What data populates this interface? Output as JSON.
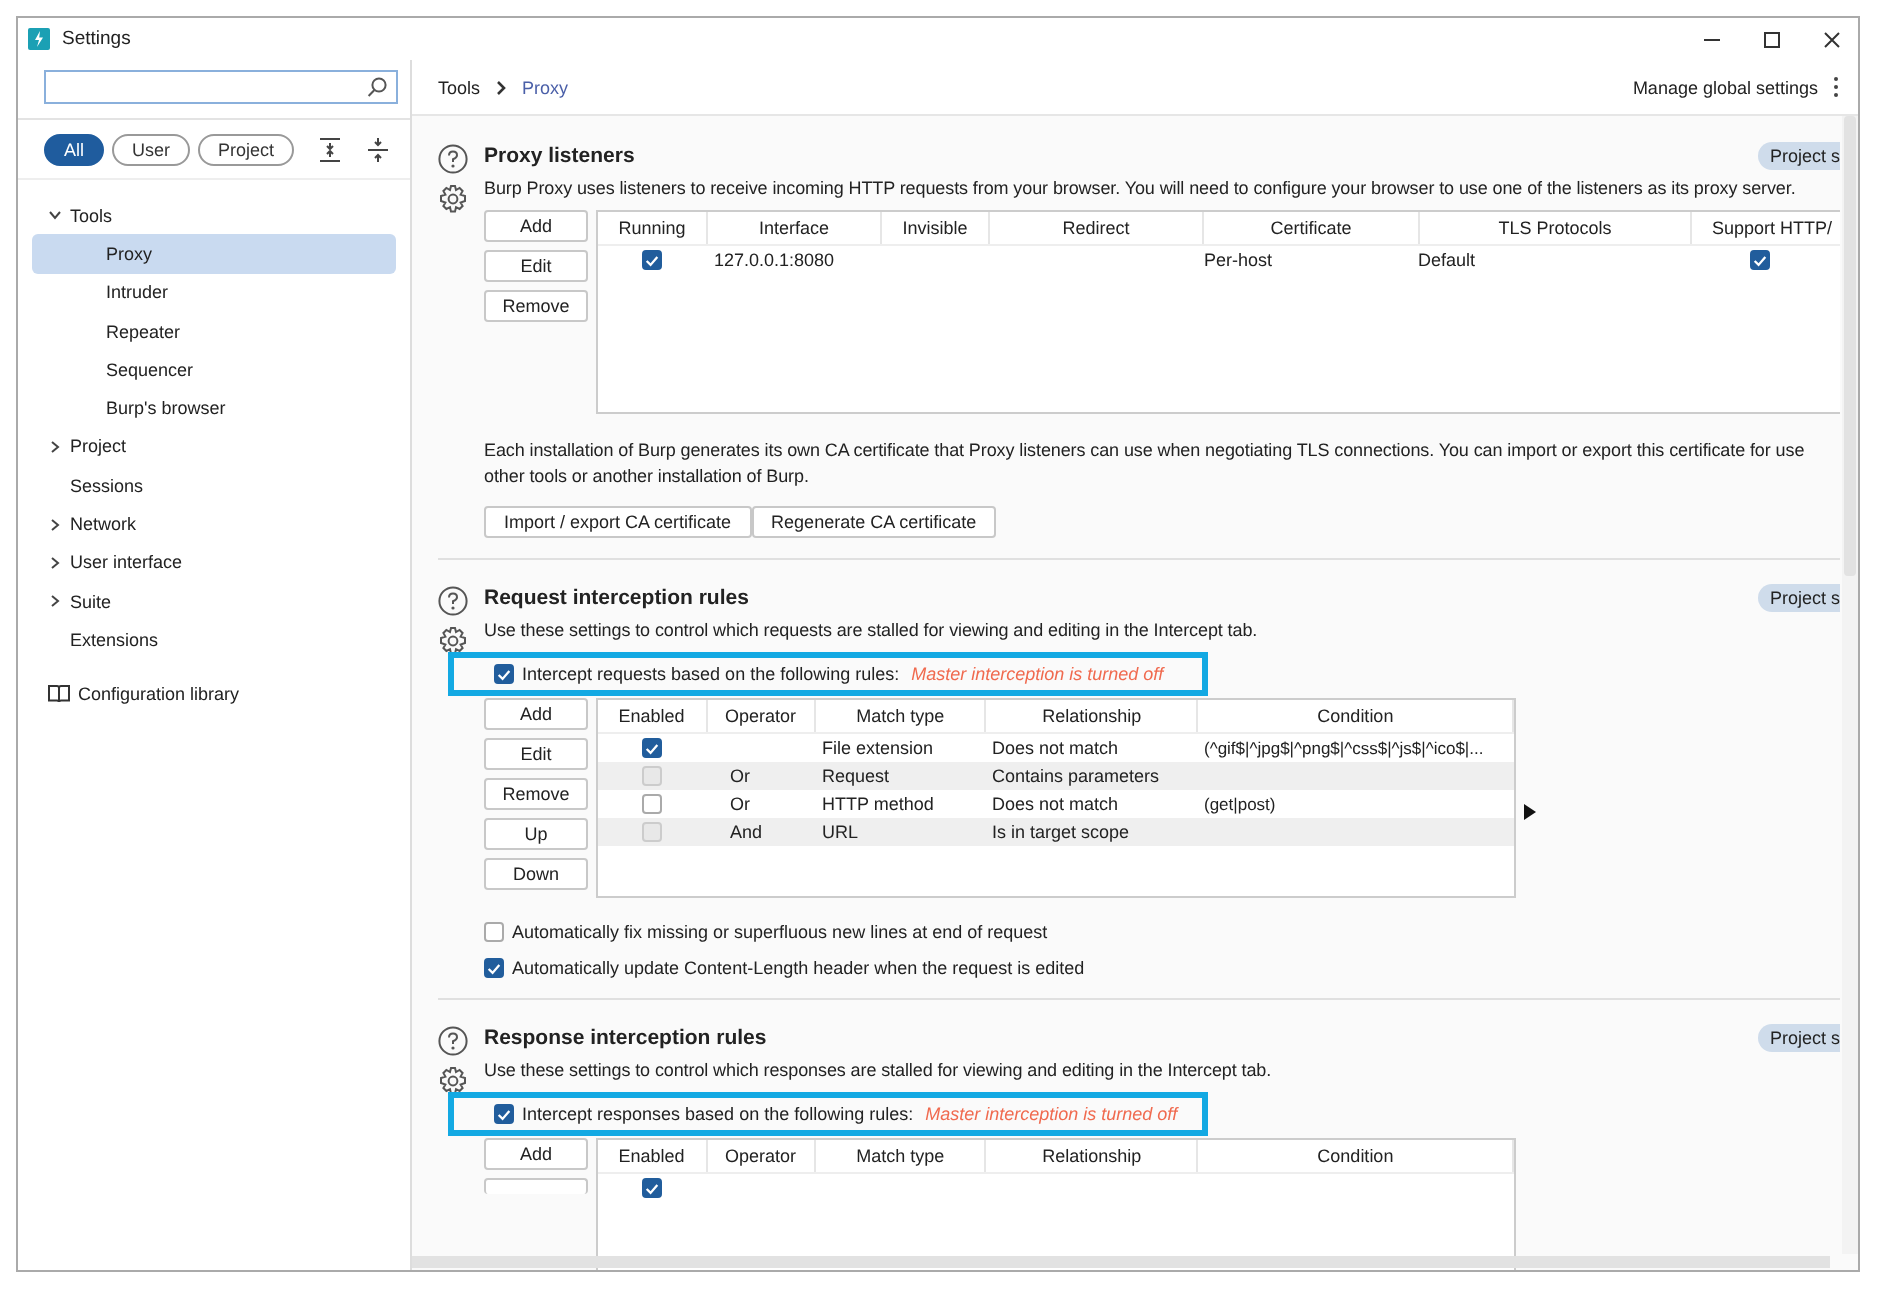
{
  "window": {
    "title": "Settings"
  },
  "sidebar": {
    "filters": [
      {
        "label": "All",
        "selected": true
      },
      {
        "label": "User",
        "selected": false
      },
      {
        "label": "Project",
        "selected": false
      }
    ],
    "tree": [
      {
        "kind": "group",
        "label": "Tools",
        "expanded": true,
        "children": [
          {
            "kind": "item",
            "label": "Proxy",
            "selected": true
          },
          {
            "kind": "item",
            "label": "Intruder",
            "selected": false
          },
          {
            "kind": "item",
            "label": "Repeater",
            "selected": false
          },
          {
            "kind": "item",
            "label": "Sequencer",
            "selected": false
          },
          {
            "kind": "item",
            "label": "Burp's browser",
            "selected": false
          }
        ]
      },
      {
        "kind": "group",
        "label": "Project",
        "expanded": false
      },
      {
        "kind": "item",
        "label": "Sessions",
        "selected": false
      },
      {
        "kind": "group",
        "label": "Network",
        "expanded": false
      },
      {
        "kind": "group",
        "label": "User interface",
        "expanded": false
      },
      {
        "kind": "group",
        "label": "Suite",
        "expanded": false
      },
      {
        "kind": "item",
        "label": "Extensions",
        "selected": false
      }
    ],
    "library": "Configuration library"
  },
  "breadcrumb": [
    "Tools",
    "Proxy"
  ],
  "manage_global": "Manage global settings",
  "proxy_listeners": {
    "title": "Proxy listeners",
    "badge": "Project s",
    "description": "Burp Proxy uses listeners to receive incoming HTTP requests from your browser. You will need to configure your browser to use one of the listeners as its proxy server.",
    "buttons": [
      "Add",
      "Edit",
      "Remove"
    ],
    "columns": [
      "Running",
      "Interface",
      "Invisible",
      "Redirect",
      "Certificate",
      "TLS Protocols",
      "Support HTTP/"
    ],
    "rows": [
      {
        "running": true,
        "interface": "127.0.0.1:8080",
        "certificate": "Per-host",
        "tls_protocols": "Default",
        "support_http": true
      }
    ],
    "ca_note": "Each installation of Burp generates its own CA certificate that Proxy listeners can use when negotiating TLS connections. You can import or export this certificate for use other tools or another installation of Burp.",
    "ca_buttons": [
      "Import / export CA certificate",
      "Regenerate CA certificate"
    ]
  },
  "request_rules": {
    "title": "Request interception rules",
    "badge": "Project s",
    "description": "Use these settings to control which requests are stalled for viewing and editing in the Intercept tab.",
    "intercept": {
      "label": "Intercept requests based on the following rules:",
      "note": "Master interception is turned off",
      "checked": true,
      "highlighted": true
    },
    "buttons": [
      "Add",
      "Edit",
      "Remove",
      "Up",
      "Down"
    ],
    "columns": [
      "Enabled",
      "Operator",
      "Match type",
      "Relationship",
      "Condition"
    ],
    "rows": [
      {
        "enabled": true,
        "match_type": "File extension",
        "relationship": "Does not match",
        "condition": "(^gif$|^jpg$|^png$|^css$|^js$|^ico$|..."
      },
      {
        "enabled": false,
        "operator": "Or",
        "match_type": "Request",
        "relationship": "Contains parameters"
      },
      {
        "enabled": false,
        "operator": "Or",
        "match_type": "HTTP method",
        "relationship": "Does not match",
        "condition": "(get|post)"
      },
      {
        "enabled": false,
        "operator": "And",
        "match_type": "URL",
        "relationship": "Is in target scope"
      }
    ],
    "options": [
      {
        "label": "Automatically fix missing or superfluous new lines at end of request",
        "checked": false
      },
      {
        "label": "Automatically update Content-Length header when the request is edited",
        "checked": true
      }
    ]
  },
  "response_rules": {
    "title": "Response interception rules",
    "badge": "Project s",
    "description": "Use these settings to control which responses are stalled for viewing and editing in the Intercept tab.",
    "intercept": {
      "label": "Intercept responses based on the following rules:",
      "note": "Master interception is turned off",
      "checked": true,
      "highlighted": true
    },
    "buttons": [
      "Add"
    ],
    "rows": [
      {
        "enabled": true
      }
    ],
    "columns": [
      "Enabled",
      "Operator",
      "Match type",
      "Relationship",
      "Condition"
    ]
  }
}
